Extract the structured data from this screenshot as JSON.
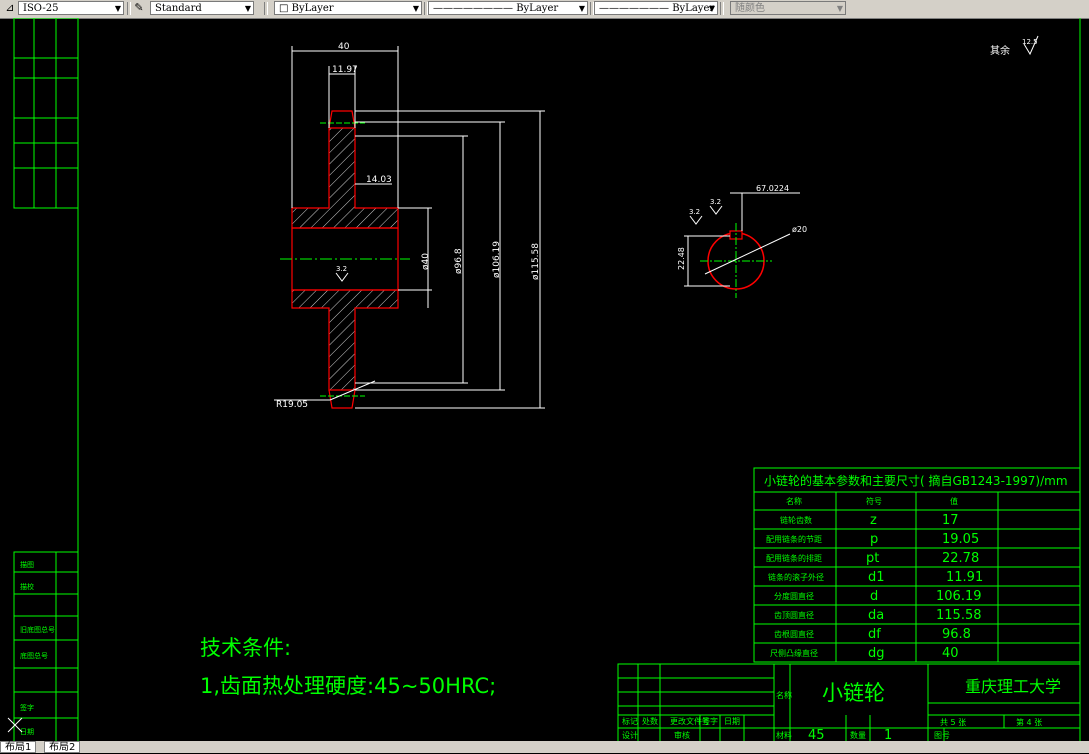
{
  "toolbar": {
    "dim_style": "ISO-25",
    "text_style": "Standard",
    "layer": "ByLayer",
    "linetype": "ByLayer",
    "lineweight": "ByLayer",
    "plot_style": "随颜色"
  },
  "drawing": {
    "dims": {
      "width": "40",
      "hub": "11.97",
      "key": "14.03",
      "bore": "ø40",
      "d_root": "ø96.8",
      "d_pitch": "ø106.19",
      "d_tip": "ø115.58",
      "radius": "R19.05",
      "rough_bore": "3.2",
      "keyway_depth": "67.0224",
      "keyway_rough_a": "3.2",
      "keyway_rough_b": "3.2",
      "keyway_width": "22.48",
      "shaft": "ø20",
      "rest_label": "其余",
      "rest_rough": "12.5"
    },
    "params_table": {
      "title": "小链轮的基本参数和主要尺寸( 摘自GB1243-1997)/mm",
      "headers": [
        "名称",
        "符号",
        "值"
      ],
      "rows": [
        [
          "链轮齿数",
          "z",
          "17"
        ],
        [
          "配用链条的节距",
          "p",
          "19.05"
        ],
        [
          "配用链条的排距",
          "pt",
          "22.78"
        ],
        [
          "链条的滚子外径",
          "d1",
          "11.91"
        ],
        [
          "分度圆直径",
          "d",
          "106.19"
        ],
        [
          "齿顶圆直径",
          "da",
          "115.58"
        ],
        [
          "齿根圆直径",
          "df",
          "96.8"
        ],
        [
          "尺侧凸缘直径",
          "dg",
          "40"
        ]
      ]
    },
    "tech": {
      "heading": "技术条件:",
      "line1": "1,齿面热处理硬度:45~50HRC;"
    },
    "title_block": {
      "part_name": "小链轮",
      "school": "重庆理工大学",
      "material_label": "材料",
      "material": "45",
      "qty_label": "数量",
      "qty": "1",
      "name_label": "名称",
      "sheets": "共 5 张",
      "sheet_no": "第 4 张",
      "drawing_label": "图号",
      "marks_row": [
        "标记",
        "处数",
        "更改文件号",
        "签字",
        "日期"
      ],
      "design_row": [
        "设计",
        "",
        "审核",
        "",
        ""
      ]
    },
    "left_strip": [
      "描图",
      "描校",
      "旧底图总号",
      "底图总号",
      "签字",
      "日期"
    ]
  },
  "tabs": [
    "布局1",
    "布局2"
  ]
}
